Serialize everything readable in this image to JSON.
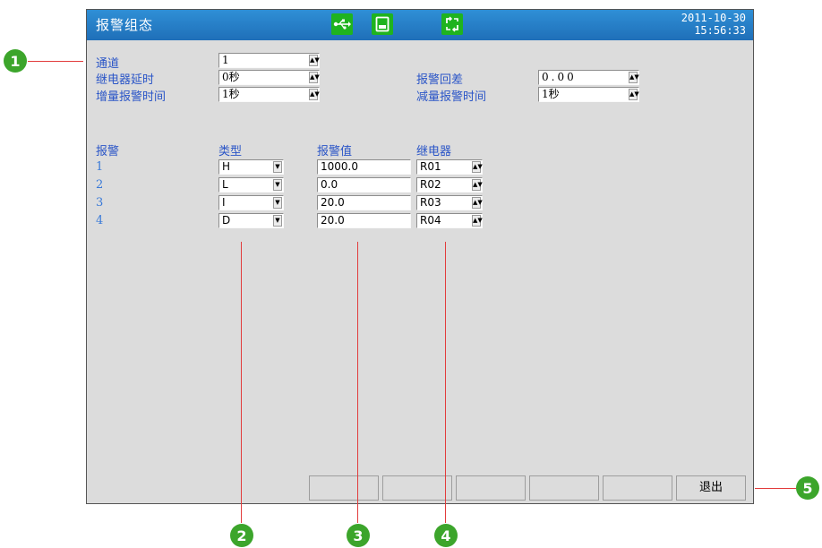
{
  "window": {
    "title": "报警组态",
    "date": "2011-10-30",
    "time": "15:56:33"
  },
  "settings": {
    "channel_label": "通道",
    "channel_value": "1",
    "relay_delay_label": "继电器延时",
    "relay_delay_value": "0秒",
    "inc_alarm_time_label": "增量报警时间",
    "inc_alarm_time_value": "1秒",
    "hysteresis_label": "报警回差",
    "hysteresis_value": "0.00",
    "dec_alarm_time_label": "减量报警时间",
    "dec_alarm_time_value": "1秒"
  },
  "table": {
    "headers": {
      "alarm": "报警",
      "type": "类型",
      "value": "报警值",
      "relay": "继电器"
    },
    "rows": [
      {
        "num": "1",
        "type": "H",
        "value": "1000.0",
        "relay": "R01"
      },
      {
        "num": "2",
        "type": "L",
        "value": "0.0",
        "relay": "R02"
      },
      {
        "num": "3",
        "type": "I",
        "value": "20.0",
        "relay": "R03"
      },
      {
        "num": "4",
        "type": "D",
        "value": "20.0",
        "relay": "R04"
      }
    ]
  },
  "footer": {
    "exit_label": "退出"
  },
  "callouts": [
    "1",
    "2",
    "3",
    "4",
    "5"
  ],
  "icons": {
    "usb": "usb-icon",
    "storage": "storage-card-icon",
    "sync": "sync-icon"
  },
  "colors": {
    "titlebar": "#1f6fb8",
    "label": "#2a55c7",
    "callout": "#3ca52b",
    "callout_line": "#e23c3c"
  }
}
